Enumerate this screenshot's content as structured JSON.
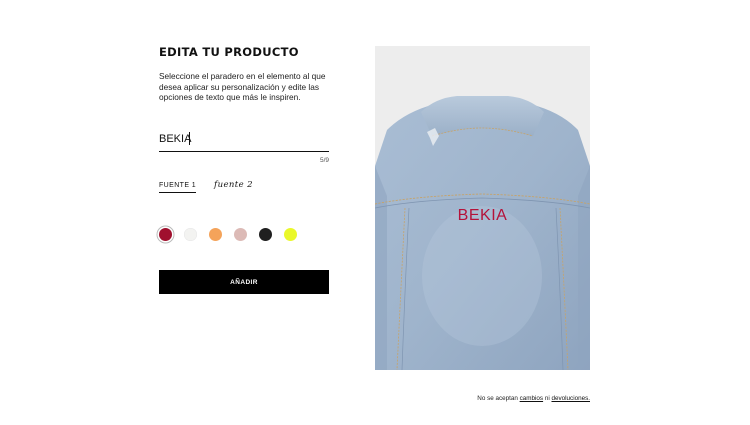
{
  "editor": {
    "title": "EDITA TU PRODUCTO",
    "description": "Seleccione el paradero en el elemento al que desea aplicar su personalización y edite las opciones de texto que más le inspiren.",
    "text_value": "BEKIA",
    "counter": "5/9"
  },
  "fonts": {
    "tabs": [
      {
        "label": "FUENTE 1",
        "active": true
      },
      {
        "label": "fuente 2",
        "active": false
      }
    ]
  },
  "colors": {
    "swatches": [
      {
        "name": "burgundy",
        "hex": "#a0102e",
        "selected": true
      },
      {
        "name": "white",
        "hex": "#f3f3f1",
        "selected": false
      },
      {
        "name": "orange",
        "hex": "#f4a35a",
        "selected": false
      },
      {
        "name": "pink",
        "hex": "#dcbab6",
        "selected": false
      },
      {
        "name": "black",
        "hex": "#1f1f1f",
        "selected": false
      },
      {
        "name": "neon-yellow",
        "hex": "#eaf82a",
        "selected": false
      }
    ]
  },
  "actions": {
    "add_label": "AÑADIR"
  },
  "preview": {
    "custom_text": "BEKIA",
    "text_color": "#b4123a"
  },
  "footer": {
    "prefix": "No se aceptan",
    "link_changes": "cambios",
    "connector": "ni",
    "link_returns": "devoluciones."
  }
}
